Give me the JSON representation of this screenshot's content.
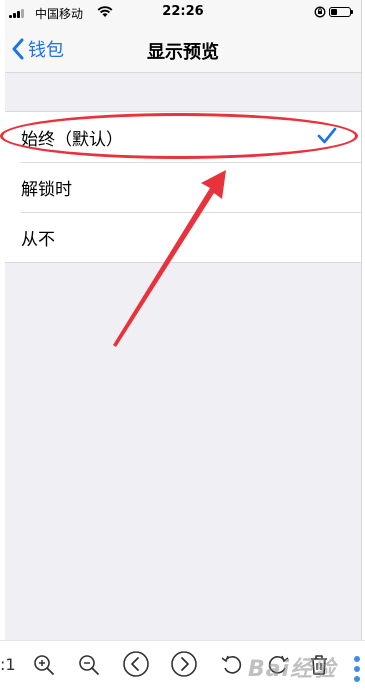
{
  "status_bar": {
    "carrier": "中国移动",
    "time": "22:26"
  },
  "nav": {
    "back_label": "钱包",
    "title": "显示预览"
  },
  "options": [
    {
      "label": "始终（默认）",
      "selected": true
    },
    {
      "label": "解锁时",
      "selected": false
    },
    {
      "label": "从不",
      "selected": false
    }
  ],
  "toolbar": {
    "fit_label": ":1",
    "watermark": "Bai经验"
  },
  "colors": {
    "accent": "#1a73e8",
    "annotation": "#e8323c",
    "background": "#efeff4"
  }
}
